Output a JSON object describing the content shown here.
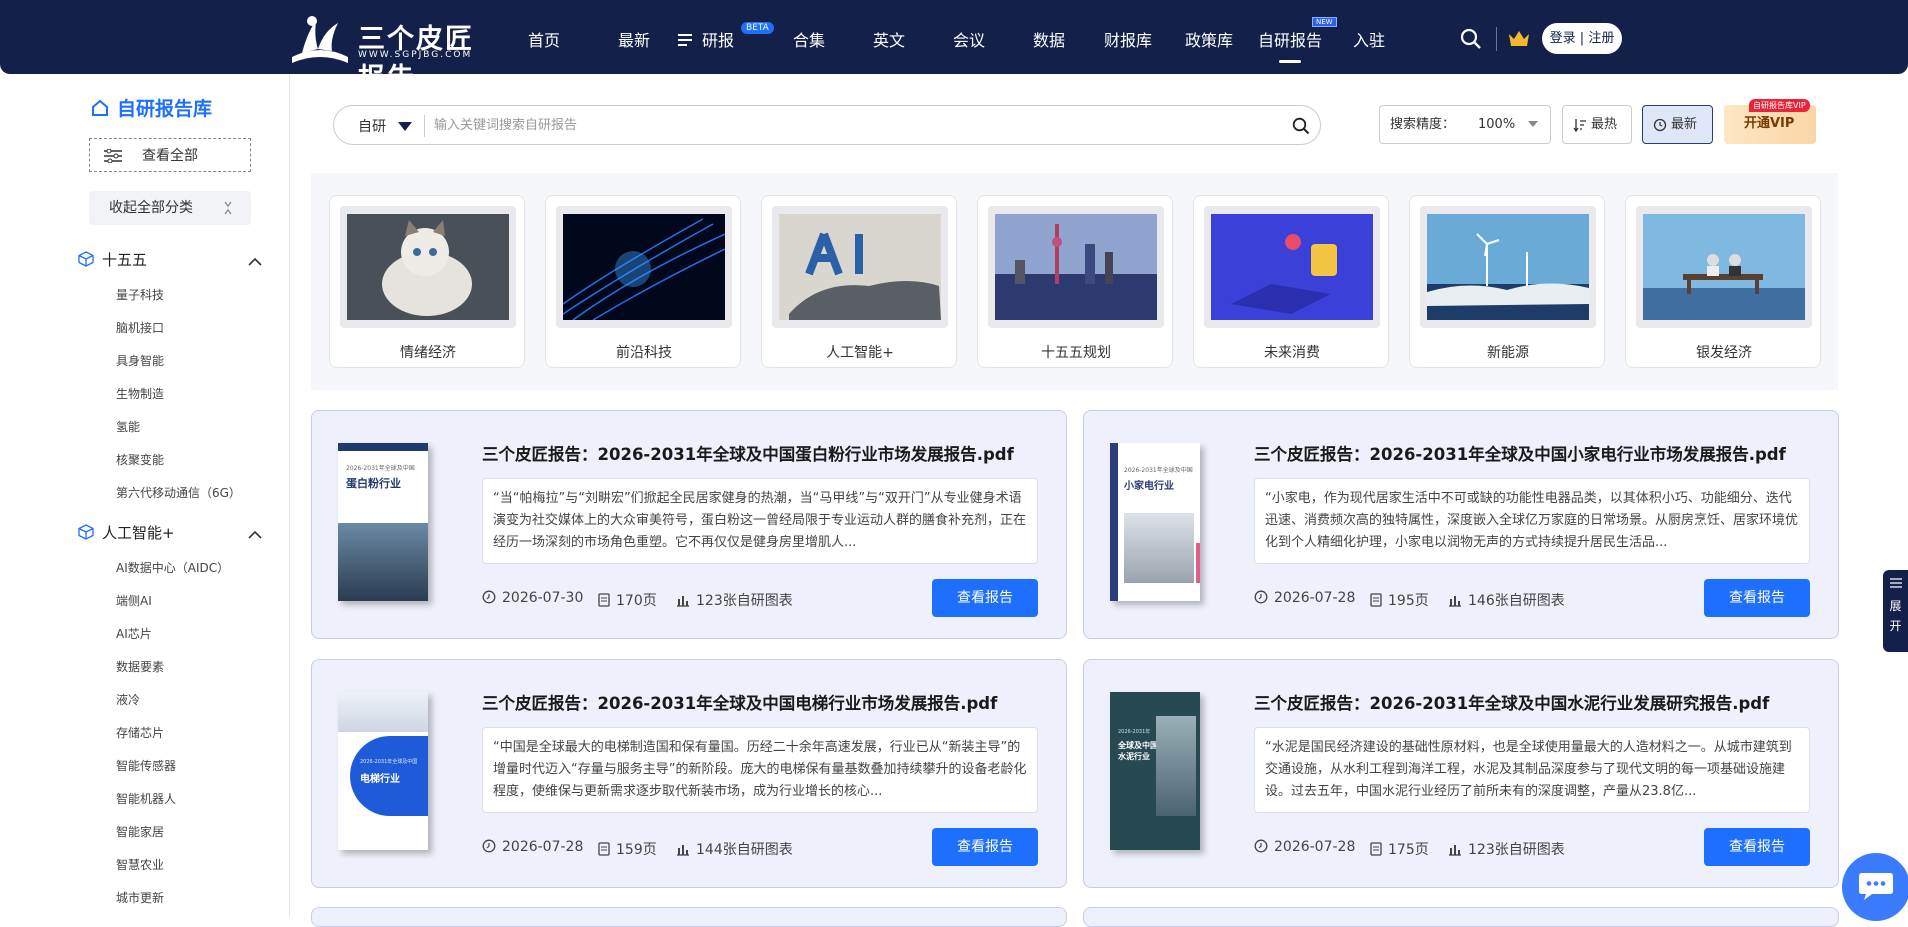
{
  "nav": {
    "logo_cn": "三个皮匠报告",
    "logo_en": "WWW.SGPJBG.COM",
    "items": [
      "首页",
      "最新",
      "研报",
      "合集",
      "英文",
      "会议",
      "数据",
      "财报库",
      "政策库",
      "自研报告",
      "入驻"
    ],
    "beta": "BETA",
    "new_badge": "NEW",
    "login": "登录 | 注册"
  },
  "sidebar": {
    "title": "自研报告库",
    "view_all": "查看全部",
    "collapse_all": "收起全部分类",
    "sections": [
      {
        "label": "十五五",
        "items": [
          "量子科技",
          "脑机接口",
          "具身智能",
          "生物制造",
          "氢能",
          "核聚变能",
          "第六代移动通信（6G）"
        ]
      },
      {
        "label": "人工智能+",
        "items": [
          "AI数据中心（AIDC）",
          "端侧AI",
          "AI芯片",
          "数据要素",
          "液冷",
          "存储芯片",
          "智能传感器",
          "智能机器人",
          "智能家居",
          "智慧农业",
          "城市更新"
        ]
      }
    ]
  },
  "search": {
    "category": "自研",
    "placeholder": "输入关键词搜索自研报告"
  },
  "controls": {
    "precision_label": "搜索精度：",
    "precision_value": "100%",
    "hot": "最热",
    "newest": "最新",
    "vip": "开通VIP",
    "vip_tag": "自研报告库VIP"
  },
  "categories": [
    "情绪经济",
    "前沿科技",
    "人工智能+",
    "十五五规划",
    "未来消费",
    "新能源",
    "银发经济"
  ],
  "reports": [
    {
      "title": "三个皮匠报告：2026-2031年全球及中国蛋白粉行业市场发展报告.pdf",
      "desc": "“当“帕梅拉”与“刘畊宏”们掀起全民居家健身的热潮，当“马甲线”与“双开门”从专业健身术语演变为社交媒体上的大众审美符号，蛋白粉这一曾经局限于专业运动人群的膳食补充剂，正在经历一场深刻的市场角色重塑。它不再仅仅是健身房里增肌人...",
      "date": "2026-07-30",
      "pages": "170页",
      "charts": "123张自研图表",
      "button": "查看报告",
      "cover_title": "蛋白粉行业",
      "cover_sub": "2026-2031年全球及中国",
      "cover_color": "#1f3a6e"
    },
    {
      "title": "三个皮匠报告：2026-2031年全球及中国小家电行业市场发展报告.pdf",
      "desc": "“小家电，作为现代居家生活中不可或缺的功能性电器品类，以其体积小巧、功能细分、迭代迅速、消费频次高的独特属性，深度嵌入全球亿万家庭的日常场景。从厨房烹饪、居家环境优化到个人精细化护理，小家电以润物无声的方式持续提升居民生活品...",
      "date": "2026-07-28",
      "pages": "195页",
      "charts": "146张自研图表",
      "button": "查看报告",
      "cover_title": "小家电行业",
      "cover_sub": "2026-2031年全球及中国",
      "cover_color": "#2d3d7a"
    },
    {
      "title": "三个皮匠报告：2026-2031年全球及中国电梯行业市场发展报告.pdf",
      "desc": "“中国是全球最大的电梯制造国和保有量国。历经二十余年高速发展，行业已从“新装主导”的增量时代迈入“存量与服务主导”的新阶段。庞大的电梯保有量基数叠加持续攀升的设备老龄化程度，使维保与更新需求逐步取代新装市场，成为行业增长的核心...",
      "date": "2026-07-28",
      "pages": "159页",
      "charts": "144张自研图表",
      "button": "查看报告",
      "cover_title": "电梯行业",
      "cover_sub": "2026-2031年全球及中国",
      "cover_color": "#1f5ad8"
    },
    {
      "title": "三个皮匠报告：2026-2031年全球及中国水泥行业发展研究报告.pdf",
      "desc": "“水泥是国民经济建设的基础性原材料，也是全球使用量最大的人造材料之一。从城市建筑到交通设施，从水利工程到海洋工程，水泥及其制品深度参与了现代文明的每一项基础设施建设。过去五年，中国水泥行业经历了前所未有的深度调整，产量从23.8亿...",
      "date": "2026-07-28",
      "pages": "175页",
      "charts": "123张自研图表",
      "button": "查看报告",
      "cover_title": "全球及中国水泥行业",
      "cover_sub": "2026-2031年",
      "cover_color": "#274a52"
    }
  ],
  "expand": "展开"
}
